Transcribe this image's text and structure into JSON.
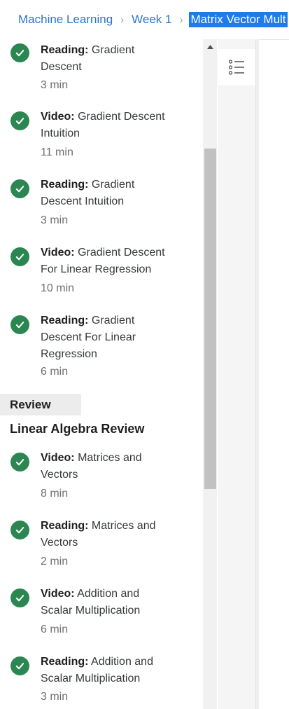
{
  "breadcrumb": {
    "items": [
      "Machine Learning",
      "Week 1"
    ],
    "current": "Matrix Vector Mult",
    "separator": "›"
  },
  "items_top": [
    {
      "type": "Reading:",
      "title": "Gradient Descent",
      "lines": [
        "Gradient",
        "Descent"
      ],
      "duration": "3 min"
    },
    {
      "type": "Video:",
      "title": "Gradient Descent Intuition",
      "lines": [
        "Gradient Descent",
        "Intuition"
      ],
      "duration": "11 min"
    },
    {
      "type": "Reading:",
      "title": "Gradient Descent Intuition",
      "lines": [
        "Gradient",
        "Descent Intuition"
      ],
      "duration": "3 min"
    },
    {
      "type": "Video:",
      "title": "Gradient Descent For Linear Regression",
      "lines": [
        "Gradient Descent",
        "For Linear Regression"
      ],
      "duration": "10 min"
    },
    {
      "type": "Reading:",
      "title": "Gradient Descent For Linear Regression",
      "lines": [
        "Gradient",
        "Descent For Linear",
        "Regression"
      ],
      "duration": "6 min"
    }
  ],
  "section": {
    "label": "Review",
    "title": "Linear Algebra Review"
  },
  "items_bottom": [
    {
      "type": "Video:",
      "title": "Matrices and Vectors",
      "lines": [
        "Matrices and",
        "Vectors"
      ],
      "duration": "8 min"
    },
    {
      "type": "Reading:",
      "title": "Matrices and Vectors",
      "lines": [
        "Matrices and",
        "Vectors"
      ],
      "duration": "2 min"
    },
    {
      "type": "Video:",
      "title": "Addition and Scalar Multiplication",
      "lines": [
        "Addition and",
        "Scalar Multiplication"
      ],
      "duration": "6 min"
    },
    {
      "type": "Reading:",
      "title": "Addition and Scalar Multiplication",
      "lines": [
        "Addition and",
        "Scalar Multiplication"
      ],
      "duration": "3 min"
    }
  ],
  "colors": {
    "link": "#2a73cc",
    "current_bg": "#1f7be8",
    "check": "#2b8651"
  },
  "icons": {
    "completed": "check-circle-icon",
    "scroll_up": "triangle-up-icon",
    "list_toggle": "list-icon"
  }
}
